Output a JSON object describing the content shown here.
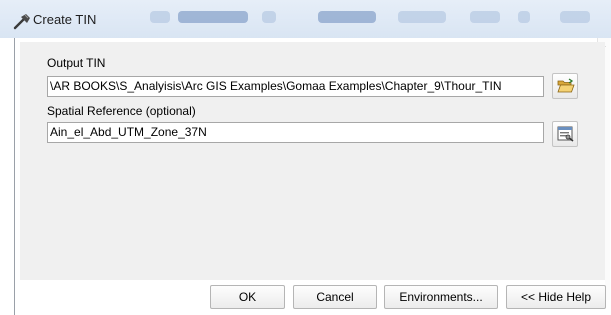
{
  "window": {
    "title": "Create TIN",
    "title_icon": "hammer-icon"
  },
  "form": {
    "output_tin": {
      "label": "Output TIN",
      "value": "\\AR BOOKS\\S_Analyisis\\Arc GIS Examples\\Gomaa Examples\\Chapter_9\\Thour_TIN",
      "browse_icon": "open-folder-icon"
    },
    "spatial_reference": {
      "label": "Spatial Reference (optional)",
      "value": "Ain_el_Abd_UTM_Zone_37N",
      "properties_icon": "properties-icon"
    }
  },
  "buttons": {
    "ok": "OK",
    "cancel": "Cancel",
    "environments": "Environments...",
    "hide_help": "<< Hide Help"
  },
  "colors": {
    "panel": "#f0f0f0",
    "titlebar": "#dfe8f4"
  }
}
